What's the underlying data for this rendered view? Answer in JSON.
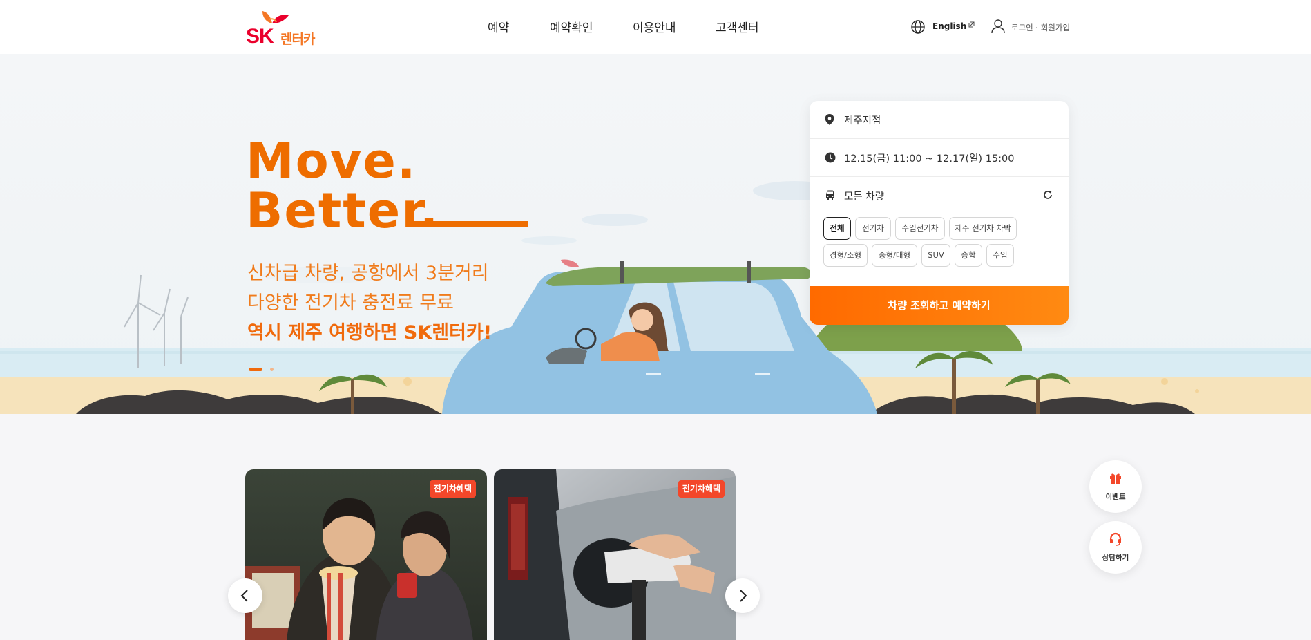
{
  "header": {
    "logo_sk": "SK",
    "logo_name": "렌터카",
    "nav": [
      "예약",
      "예약확인",
      "이용안내",
      "고객센터"
    ],
    "language_label": "English",
    "login_label": "로그인 · 회원가입"
  },
  "hero": {
    "slogan_line1": "Move.",
    "slogan_line2": "Better.",
    "copy_line1": "신차급 차량, 공항에서 3분거리",
    "copy_line2": "다양한 전기차 충전료 무료",
    "copy_line3": "역시 제주 여행하면 SK렌터카!",
    "slide_count": 2,
    "active_slide": 1
  },
  "booking": {
    "location": "제주지점",
    "datetime": "12.15(금) 11:00 ~ 12.17(일) 15:00",
    "vehicle_type": "모든 차량",
    "chips": [
      "전체",
      "전기차",
      "수입전기차",
      "제주 전기차 차박",
      "경형/소형",
      "중형/대형",
      "SUV",
      "승합",
      "수입"
    ],
    "selected_chip": "전체",
    "cta_label": "차량 조회하고 예약하기"
  },
  "banners": [
    {
      "badge": "전기차혜택"
    },
    {
      "badge": "전기차혜택"
    }
  ],
  "floating": {
    "event_label": "이벤트",
    "consult_label": "상담하기"
  },
  "colors": {
    "brand_orange": "#ee6d00",
    "sk_red": "#ea002c",
    "badge_red": "#f3472a"
  }
}
